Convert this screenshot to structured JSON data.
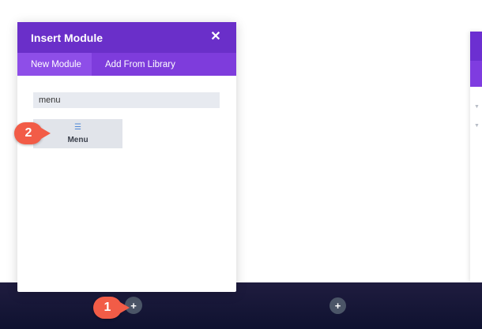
{
  "modal": {
    "title": "Insert Module",
    "close_glyph": "✕",
    "tabs": [
      {
        "label": "New Module",
        "active": true
      },
      {
        "label": "Add From Library",
        "active": false
      }
    ],
    "search": {
      "value": "menu",
      "placeholder": ""
    },
    "modules": [
      {
        "label": "Menu",
        "icon": "hamburger-menu-icon"
      }
    ]
  },
  "bottom_bar": {
    "add_left": "+",
    "add_right": "+"
  },
  "annotations": {
    "step_1": "1",
    "step_2": "2"
  },
  "colors": {
    "header": "#6a2fc9",
    "tabs": "#7e3cdc",
    "active_tab": "#8e4ee8",
    "badge": "#f25c47",
    "bottom_bar": "#1f1c3f",
    "add_button": "#4b5567",
    "menu_icon": "#4e87d6"
  }
}
